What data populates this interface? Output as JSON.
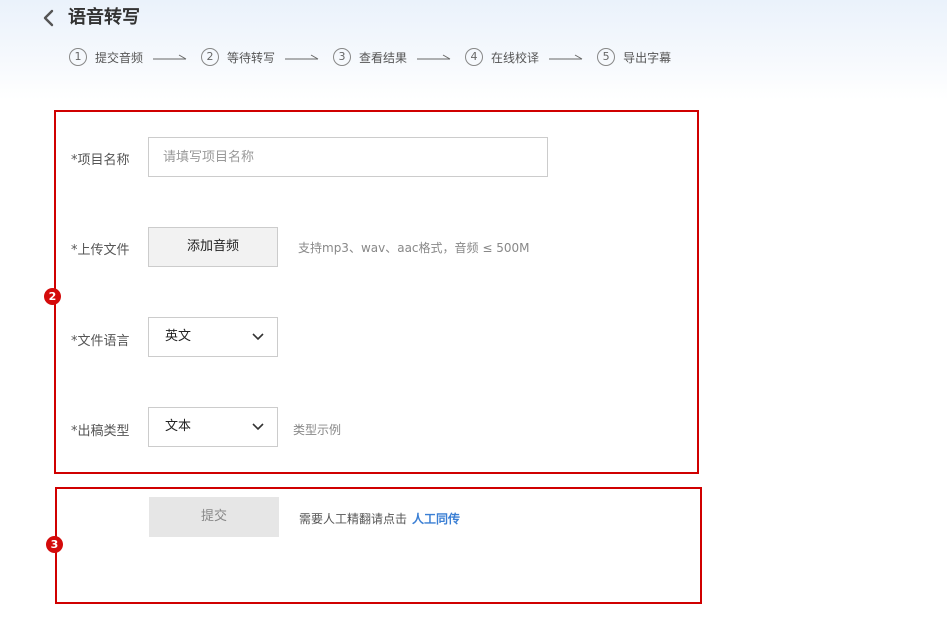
{
  "header": {
    "back_icon": "chevron-left-icon",
    "title": "语音转写"
  },
  "steps": [
    {
      "num": "1",
      "label": "提交音频"
    },
    {
      "num": "2",
      "label": "等待转写"
    },
    {
      "num": "3",
      "label": "查看结果"
    },
    {
      "num": "4",
      "label": "在线校译"
    },
    {
      "num": "5",
      "label": "导出字幕"
    }
  ],
  "markers": {
    "m2": "2",
    "m3": "3"
  },
  "form": {
    "project_name": {
      "label": "*项目名称",
      "placeholder": "请填写项目名称",
      "value": ""
    },
    "upload": {
      "label": "*上传文件",
      "button": "添加音频",
      "hint": "支持mp3、wav、aac格式，音频 ≤ 500M"
    },
    "language": {
      "label": "*文件语言",
      "selected": "英文",
      "icon": "chevron-down-icon"
    },
    "output_type": {
      "label": "*出稿类型",
      "selected": "文本",
      "hint": "类型示例",
      "icon": "chevron-down-icon"
    }
  },
  "submit": {
    "button": "提交",
    "note": "需要人工精翻请点击",
    "link": "人工同传"
  },
  "colors": {
    "annotation": "#d00000",
    "link": "#3b7fd4"
  }
}
